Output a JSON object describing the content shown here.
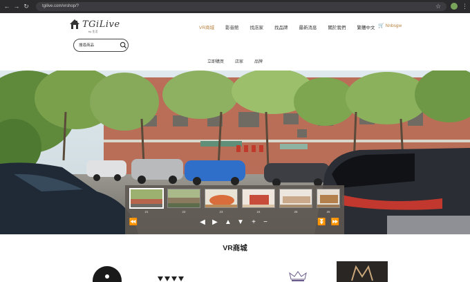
{
  "browser": {
    "url": "tgilive.com/vrshop/?",
    "icons": [
      "back-icon",
      "forward-icon",
      "reload-icon",
      "lock-icon",
      "star-icon",
      "extension-icon",
      "menu-icon"
    ]
  },
  "site": {
    "brand": "TGiLive",
    "tagline": "by 生活",
    "nav": [
      {
        "label": "VR商城",
        "active": true
      },
      {
        "label": "影音館",
        "active": false
      },
      {
        "label": "找店家",
        "active": false
      },
      {
        "label": "找品牌",
        "active": false
      },
      {
        "label": "最新消息",
        "active": false
      },
      {
        "label": "關於我們",
        "active": false
      },
      {
        "label": "繁體中文",
        "active": false
      }
    ],
    "cart_label": "Nnbsgw",
    "search_placeholder": "搜尋商品",
    "subnav": [
      "立即購買",
      "店家",
      "品牌"
    ],
    "accent_color": "#b9803e"
  },
  "tour": {
    "thumbnails": [
      {
        "label": "21",
        "selected": true
      },
      {
        "label": "22",
        "selected": false
      },
      {
        "label": "23",
        "selected": false
      },
      {
        "label": "24",
        "selected": false
      },
      {
        "label": "25",
        "selected": false
      },
      {
        "label": "26",
        "selected": false
      }
    ],
    "controls": [
      "rewind-icon",
      "left-arrow-icon",
      "right-arrow-icon",
      "up-arrow-icon",
      "down-arrow-icon",
      "zoom-in-icon",
      "zoom-out-icon",
      "hide-panel-icon",
      "fast-forward-icon"
    ]
  },
  "section": {
    "title": "VR商城"
  }
}
